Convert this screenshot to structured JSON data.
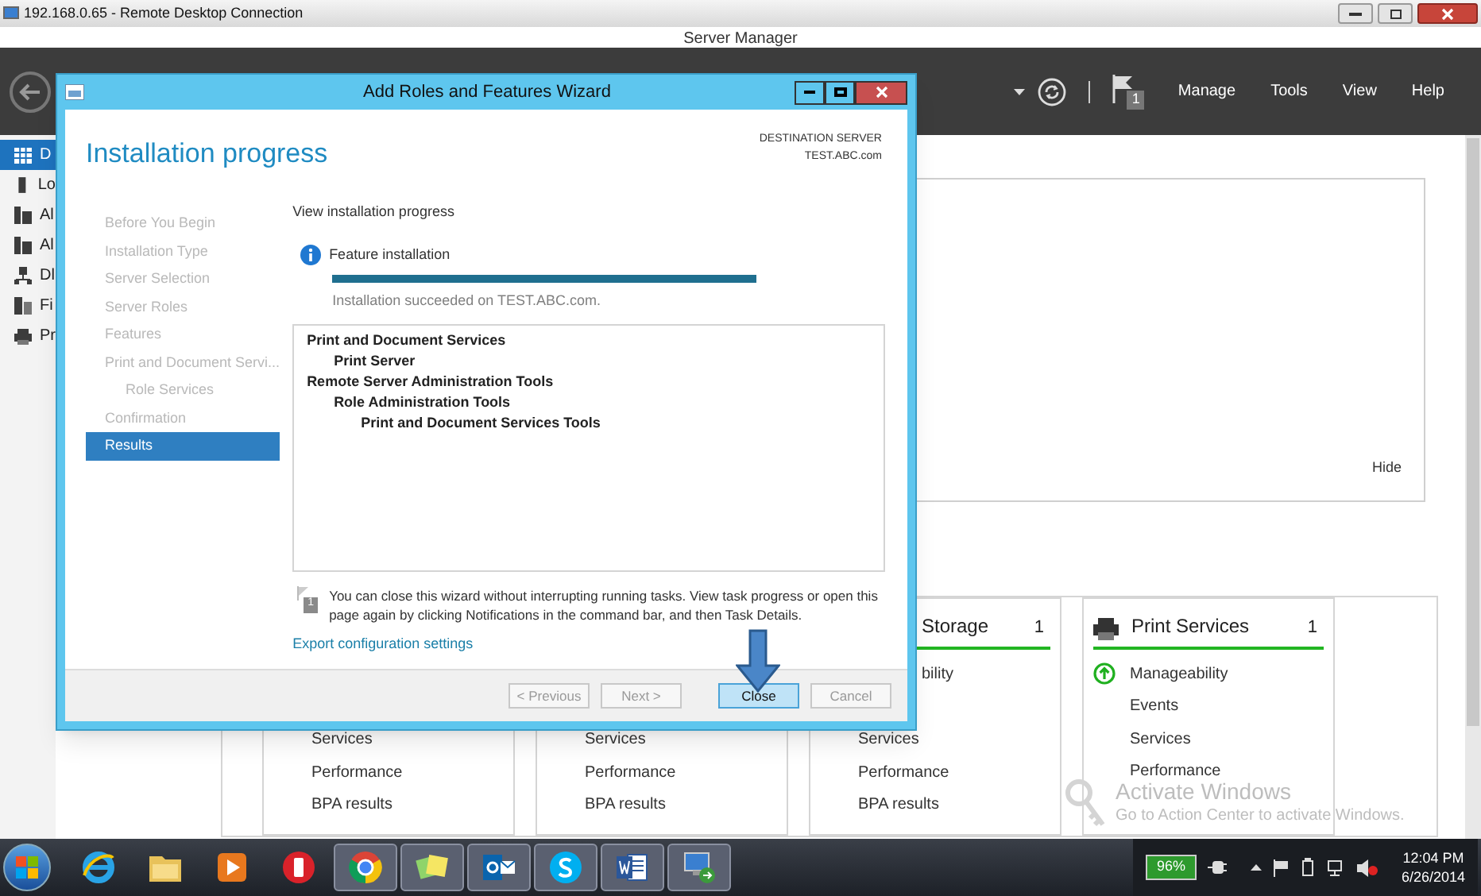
{
  "rdp_window": {
    "title": "192.168.0.65 - Remote Desktop Connection"
  },
  "server_manager": {
    "title": "Server Manager",
    "notification_count": "1",
    "menu": [
      "Manage",
      "Tools",
      "View",
      "Help"
    ],
    "nav": [
      {
        "label": "D",
        "kind": "dashboard",
        "selected": true
      },
      {
        "label": "Lo",
        "kind": "server",
        "selected": false
      },
      {
        "label": "Al",
        "kind": "servers",
        "selected": false
      },
      {
        "label": "Al",
        "kind": "servers2",
        "selected": false
      },
      {
        "label": "Dl",
        "kind": "network",
        "selected": false
      },
      {
        "label": "Fi",
        "kind": "files",
        "selected": false
      },
      {
        "label": "Pr",
        "kind": "printer",
        "selected": false
      }
    ],
    "hide_link": "Hide",
    "tiles": [
      {
        "kind": "covered",
        "lower": [
          "Services",
          "Performance",
          "BPA results"
        ]
      },
      {
        "kind": "covered",
        "lower": [
          "Services",
          "Performance",
          "BPA results"
        ]
      },
      {
        "kind": "covered",
        "title": "Storage",
        "count": "1",
        "healthy": true,
        "upper": [
          {
            "label": "bility"
          }
        ],
        "lower": [
          "Services",
          "Performance",
          "BPA results"
        ]
      },
      {
        "kind": "full",
        "title": "Print Services",
        "count": "1",
        "healthy": true,
        "upper": [
          {
            "label": "Manageability",
            "healthy": true
          },
          {
            "label": "Events"
          },
          {
            "label": "Services"
          },
          {
            "label": "Performance"
          }
        ]
      }
    ],
    "activation": {
      "title": "Activate Windows",
      "text": "Go to Action Center to activate Windows."
    }
  },
  "wizard": {
    "title": "Add Roles and Features Wizard",
    "page_title": "Installation progress",
    "destination_label": "DESTINATION SERVER",
    "destination_server": "TEST.ABC.com",
    "steps": [
      {
        "label": "Before You Begin",
        "selected": false
      },
      {
        "label": "Installation Type",
        "selected": false
      },
      {
        "label": "Server Selection",
        "selected": false
      },
      {
        "label": "Server Roles",
        "selected": false
      },
      {
        "label": "Features",
        "selected": false
      },
      {
        "label": "Print and Document Servi...",
        "selected": false,
        "children": [
          {
            "label": "Role Services",
            "selected": false
          }
        ]
      },
      {
        "label": "Confirmation",
        "selected": false
      },
      {
        "label": "Results",
        "selected": true
      }
    ],
    "section_label": "View installation progress",
    "status": {
      "title": "Feature installation",
      "level": 1,
      "message": "Installation succeeded on TEST.ABC.com."
    },
    "results": [
      {
        "label": "Print and Document Services",
        "children": [
          {
            "label": "Print Server"
          }
        ]
      },
      {
        "label": "Remote Server Administration Tools",
        "children": [
          {
            "label": "Role Administration Tools",
            "children": [
              {
                "label": "Print and Document Services Tools"
              }
            ]
          }
        ]
      }
    ],
    "note_badge": "1",
    "note": "You can close this wizard without interrupting running tasks. View task progress or open this page again by clicking Notifications in the command bar, and then Task Details.",
    "export_link": "Export configuration settings",
    "buttons": [
      {
        "label": "< Previous",
        "disabled": true,
        "default": false
      },
      {
        "label": "Next >",
        "disabled": true,
        "default": false
      },
      {
        "label": "Close",
        "disabled": false,
        "default": true
      },
      {
        "label": "Cancel",
        "disabled": true,
        "default": false
      }
    ]
  },
  "taskbar": {
    "apps": [
      {
        "kind": "ie",
        "running": false
      },
      {
        "kind": "folder",
        "running": false
      },
      {
        "kind": "media",
        "running": false
      },
      {
        "kind": "red-app",
        "running": false
      },
      {
        "kind": "chrome",
        "running": true
      },
      {
        "kind": "notes",
        "running": true
      },
      {
        "kind": "outlook",
        "running": true
      },
      {
        "kind": "skype",
        "running": true
      },
      {
        "kind": "word",
        "running": true
      },
      {
        "kind": "remote",
        "running": true
      }
    ],
    "battery": "96%",
    "time": "12:04 PM",
    "date": "6/26/2014"
  }
}
